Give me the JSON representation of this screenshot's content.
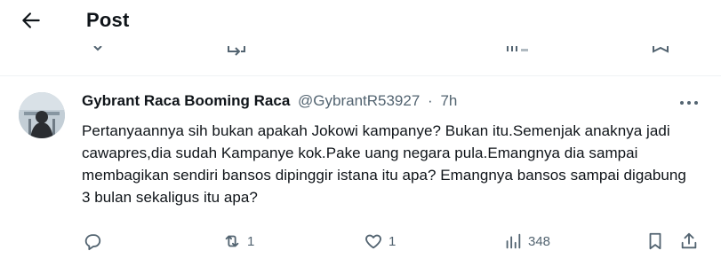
{
  "header": {
    "title": "Post"
  },
  "post": {
    "author_name": "Gybrant Raca Booming Raca",
    "author_handle": "@GybrantR53927",
    "separator": "·",
    "time": "7h",
    "text": "Pertanyaannya sih bukan apakah Jokowi kampanye? Bukan itu.Semenjak anaknya jadi cawapres,dia sudah Kampanye kok.Pake uang negara pula.Emangnya dia sampai membagikan sendiri bansos dipinggir istana itu apa? Emangnya bansos sampai digabung 3 bulan sekaligus itu apa?",
    "reply_count": "",
    "repost_count": "1",
    "like_count": "1",
    "views_count": "348"
  },
  "icons": {
    "back": "arrow-left-icon",
    "more": "more-horizontal-icon",
    "reply": "comment-icon",
    "repost": "repost-icon",
    "like": "heart-icon",
    "views": "bar-chart-icon",
    "bookmark": "bookmark-icon",
    "share": "share-icon"
  },
  "colors": {
    "text": "#0f1419",
    "secondary": "#536471",
    "divider": "#eff3f4"
  }
}
